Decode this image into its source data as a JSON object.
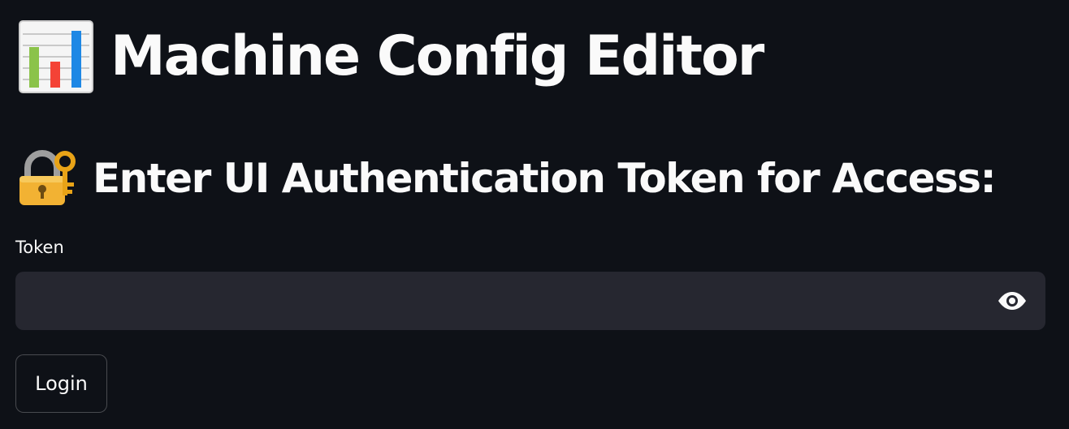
{
  "header": {
    "title": "Machine Config Editor",
    "title_icon": "bar-chart-icon"
  },
  "auth": {
    "heading": "Enter UI Authentication Token for Access:",
    "heading_icon": "locked-with-key-icon",
    "token_label": "Token",
    "token_value": "",
    "reveal_icon": "eye-icon",
    "login_label": "Login"
  },
  "colors": {
    "background": "#0e1117",
    "input_background": "#262730",
    "text": "#fafafa",
    "bar_green": "#8bc34a",
    "bar_red": "#f44336",
    "bar_blue": "#1e88e5",
    "lock_gold": "#f2b233",
    "key_gold": "#e8a317"
  }
}
